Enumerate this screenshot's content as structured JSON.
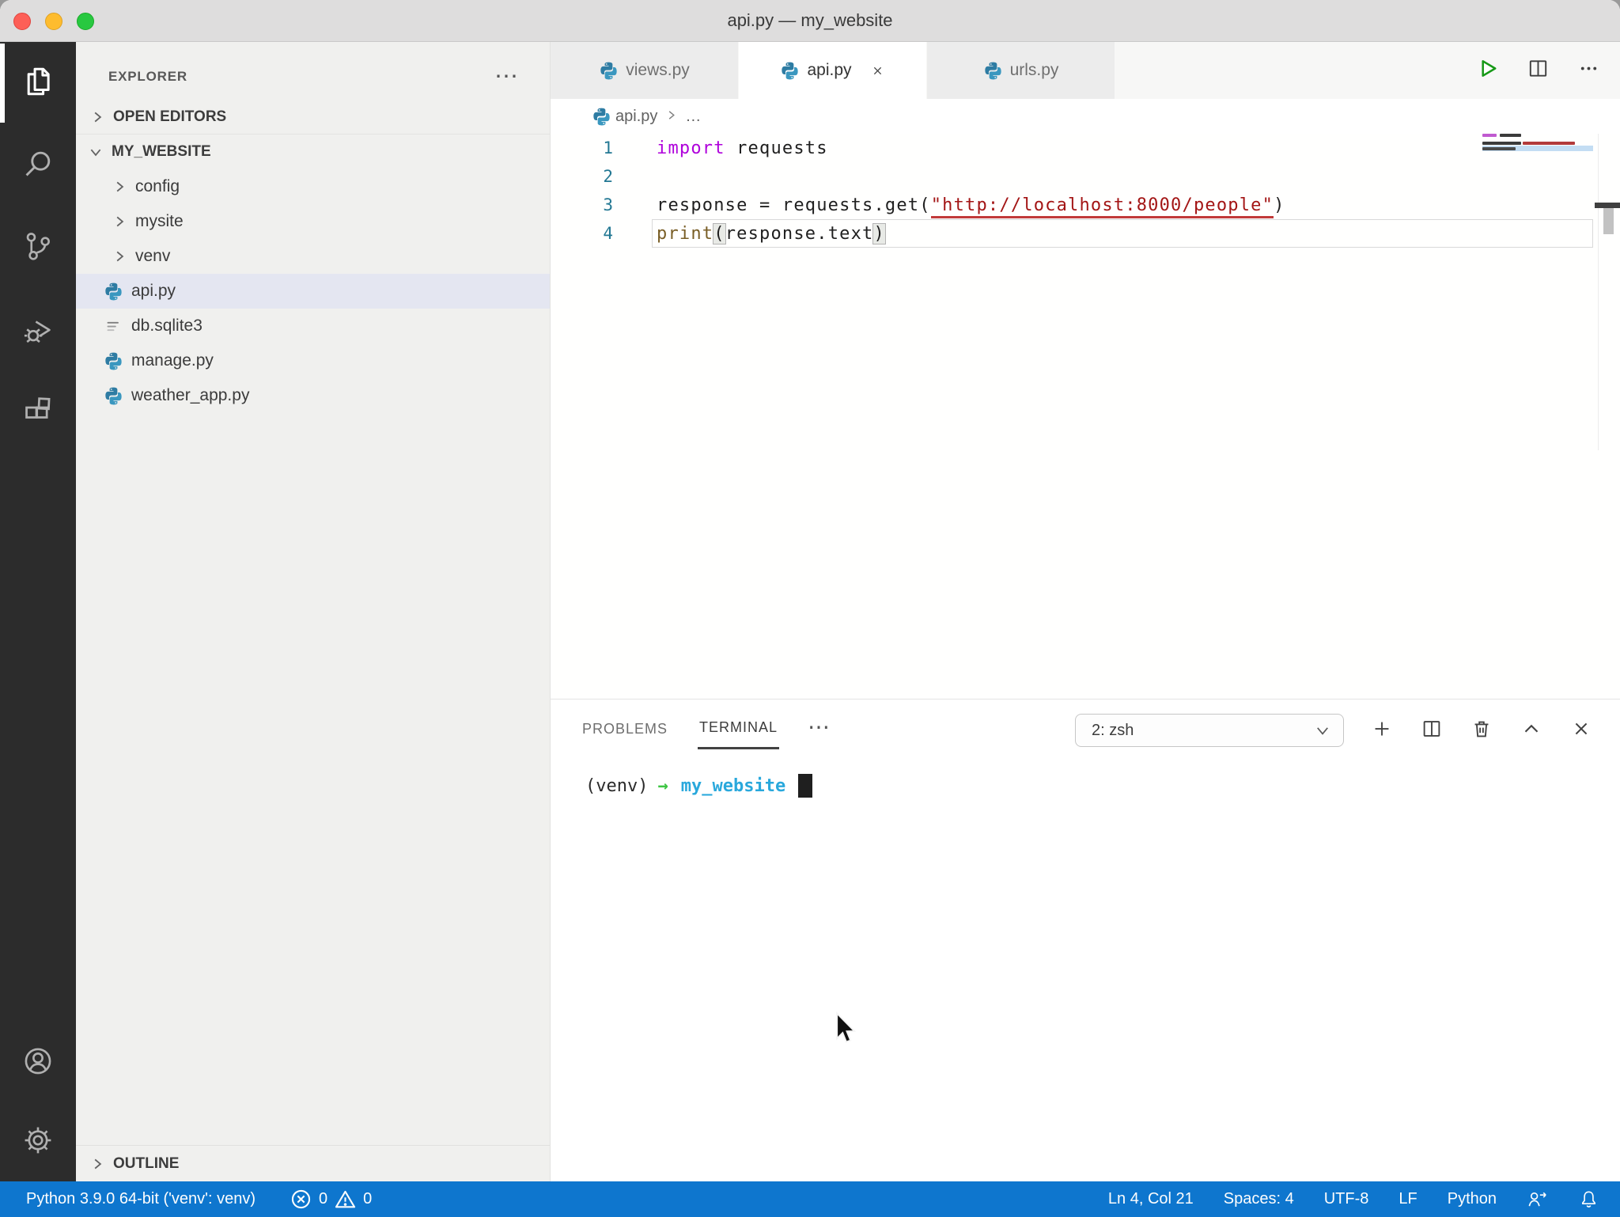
{
  "window": {
    "title": "api.py — my_website"
  },
  "activity_bar": {
    "items": [
      {
        "name": "explorer",
        "icon": "files-icon",
        "active": true
      },
      {
        "name": "search",
        "icon": "search-icon",
        "active": false
      },
      {
        "name": "source-control",
        "icon": "source-control-icon",
        "active": false
      },
      {
        "name": "run-and-debug",
        "icon": "run-debug-icon",
        "active": false
      },
      {
        "name": "extensions",
        "icon": "extensions-icon",
        "active": false
      }
    ],
    "bottom": [
      {
        "name": "accounts",
        "icon": "account-icon"
      },
      {
        "name": "manage",
        "icon": "settings-gear-icon"
      }
    ]
  },
  "sidebar": {
    "title": "EXPLORER",
    "more": "⋯",
    "open_editors_label": "OPEN EDITORS",
    "root_label": "MY_WEBSITE",
    "outline_label": "OUTLINE",
    "tree": [
      {
        "label": "config",
        "kind": "folder",
        "selected": false
      },
      {
        "label": "mysite",
        "kind": "folder",
        "selected": false
      },
      {
        "label": "venv",
        "kind": "folder",
        "selected": false
      },
      {
        "label": "api.py",
        "kind": "python-file",
        "selected": true
      },
      {
        "label": "db.sqlite3",
        "kind": "database-file",
        "selected": false
      },
      {
        "label": "manage.py",
        "kind": "python-file",
        "selected": false
      },
      {
        "label": "weather_app.py",
        "kind": "python-file",
        "selected": false
      }
    ]
  },
  "editor": {
    "tabs": [
      {
        "label": "views.py",
        "active": false
      },
      {
        "label": "api.py",
        "active": true
      },
      {
        "label": "urls.py",
        "active": false
      }
    ],
    "actions": [
      {
        "name": "run-python-file",
        "icon": "run-icon"
      },
      {
        "name": "split-editor",
        "icon": "split-editor-icon"
      },
      {
        "name": "more-actions",
        "icon": "more-icon"
      }
    ],
    "breadcrumb": {
      "file": "api.py",
      "ellipsis": "…"
    },
    "code": {
      "language": "python",
      "lines": [
        {
          "n": "1",
          "current": false,
          "tokens": [
            {
              "t": "import",
              "c": "kw"
            },
            {
              "t": " requests",
              "c": "plain"
            }
          ]
        },
        {
          "n": "2",
          "current": false,
          "tokens": []
        },
        {
          "n": "3",
          "current": false,
          "tokens": [
            {
              "t": "response ",
              "c": "plain"
            },
            {
              "t": "= ",
              "c": "plain"
            },
            {
              "t": "requests.get(",
              "c": "plain"
            },
            {
              "t": "\"http://localhost:8000/people\"",
              "c": "str"
            },
            {
              "t": ")",
              "c": "plain"
            }
          ]
        },
        {
          "n": "4",
          "current": true,
          "tokens": [
            {
              "t": "print",
              "c": "fn"
            },
            {
              "t": "(",
              "c": "plain bracket"
            },
            {
              "t": "response.text",
              "c": "plain"
            },
            {
              "t": ")",
              "c": "plain bracket"
            }
          ]
        }
      ]
    }
  },
  "panel": {
    "tabs": [
      {
        "label": "PROBLEMS",
        "active": false
      },
      {
        "label": "TERMINAL",
        "active": true
      }
    ],
    "more": "⋯",
    "shell_selector": {
      "value": "2: zsh"
    },
    "actions": [
      {
        "name": "new-terminal",
        "icon": "plus-icon"
      },
      {
        "name": "split-terminal",
        "icon": "split-editor-icon"
      },
      {
        "name": "kill-terminal",
        "icon": "trash-icon"
      },
      {
        "name": "maximize-panel",
        "icon": "chevron-up-icon"
      },
      {
        "name": "close-panel",
        "icon": "close-icon"
      }
    ],
    "terminal": {
      "prompt_prefix": "(venv)",
      "prompt_arrow": "→",
      "cwd": "my_website"
    }
  },
  "status_bar": {
    "interpreter": "Python 3.9.0 64-bit ('venv': venv)",
    "errors": "0",
    "warnings": "0",
    "right_items": [
      {
        "name": "cursor-position",
        "label": "Ln 4, Col 21"
      },
      {
        "name": "indentation",
        "label": "Spaces: 4"
      },
      {
        "name": "encoding",
        "label": "UTF-8"
      },
      {
        "name": "eol",
        "label": "LF"
      },
      {
        "name": "language-mode",
        "label": "Python"
      }
    ]
  },
  "colors": {
    "status_bar": "#0E76CE",
    "list_selection": "#E4E6F1",
    "keyword": "#AF00DB",
    "string": "#A31515",
    "function": "#795E26",
    "terminal_cwd": "#29A8DC",
    "terminal_arrow": "#3DC543",
    "run_green": "#179917"
  }
}
